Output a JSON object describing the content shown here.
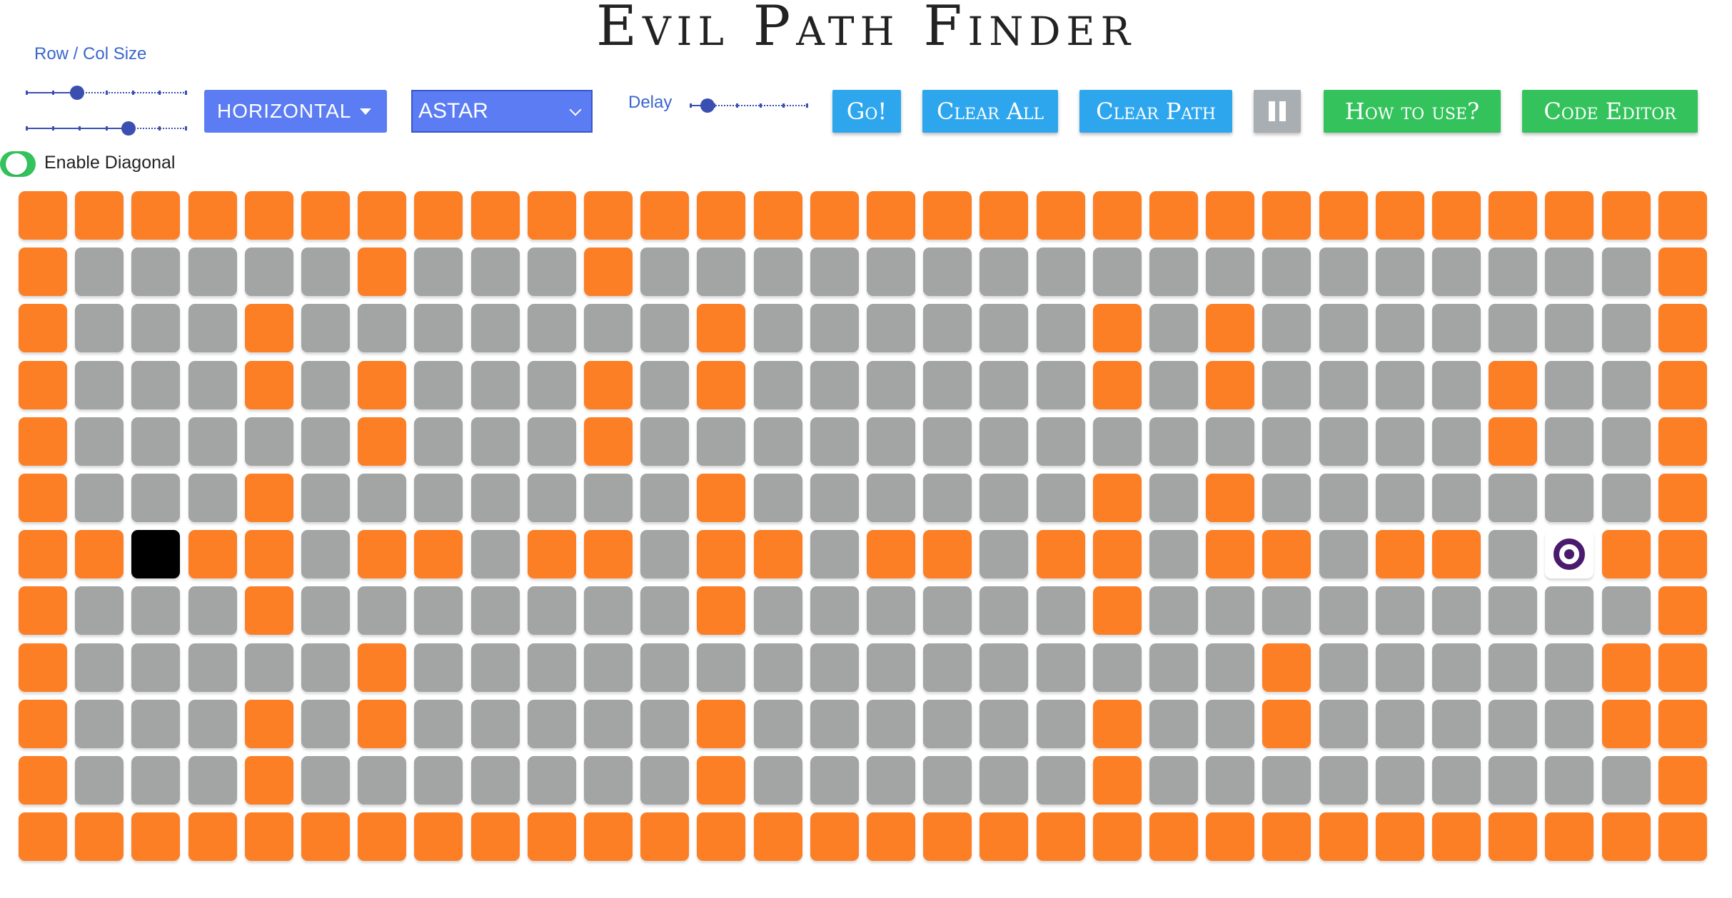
{
  "title": "Evil Path Finder",
  "controls": {
    "size_label": "Row / Col Size",
    "direction": "HORIZONTAL",
    "algorithm": "ASTAR",
    "delay_label": "Delay",
    "go": "Go!",
    "clear_all": "Clear All",
    "clear_path": "Clear Path",
    "how_to_use": "How to use?",
    "code_editor": "Code Editor",
    "enable_diagonal": "Enable Diagonal",
    "diagonal_enabled": true,
    "row_size_level": 0.3,
    "col_size_level": 0.65,
    "delay_level": 0.1
  },
  "colors": {
    "wall": "#fc7f26",
    "empty": "#a2a5a3",
    "start": "#000000",
    "target": "#4a1a6e",
    "button_blue": "#2ea6ee",
    "button_green": "#33c25b",
    "dropdown": "#5b7cf2"
  },
  "grid": {
    "rows": 12,
    "cols": 30,
    "legend": "# = wall, . = empty, S = start, T = target",
    "cells": [
      "##############################",
      "#.....#...#..................#",
      "#...#.......#......#.#.......#",
      "#...#.#...#.#......#.#....#..#",
      "#.....#...#...............#..#",
      "#...#.......#......#.#.......#",
      "##S##.##.##.##.##.##.##.##.T##",
      "#...#.......#......#.........#",
      "#.....#...............#.....##",
      "#...#.#.....#......#..#.....##",
      "#...#.......#......#.........#",
      "##############################"
    ]
  }
}
